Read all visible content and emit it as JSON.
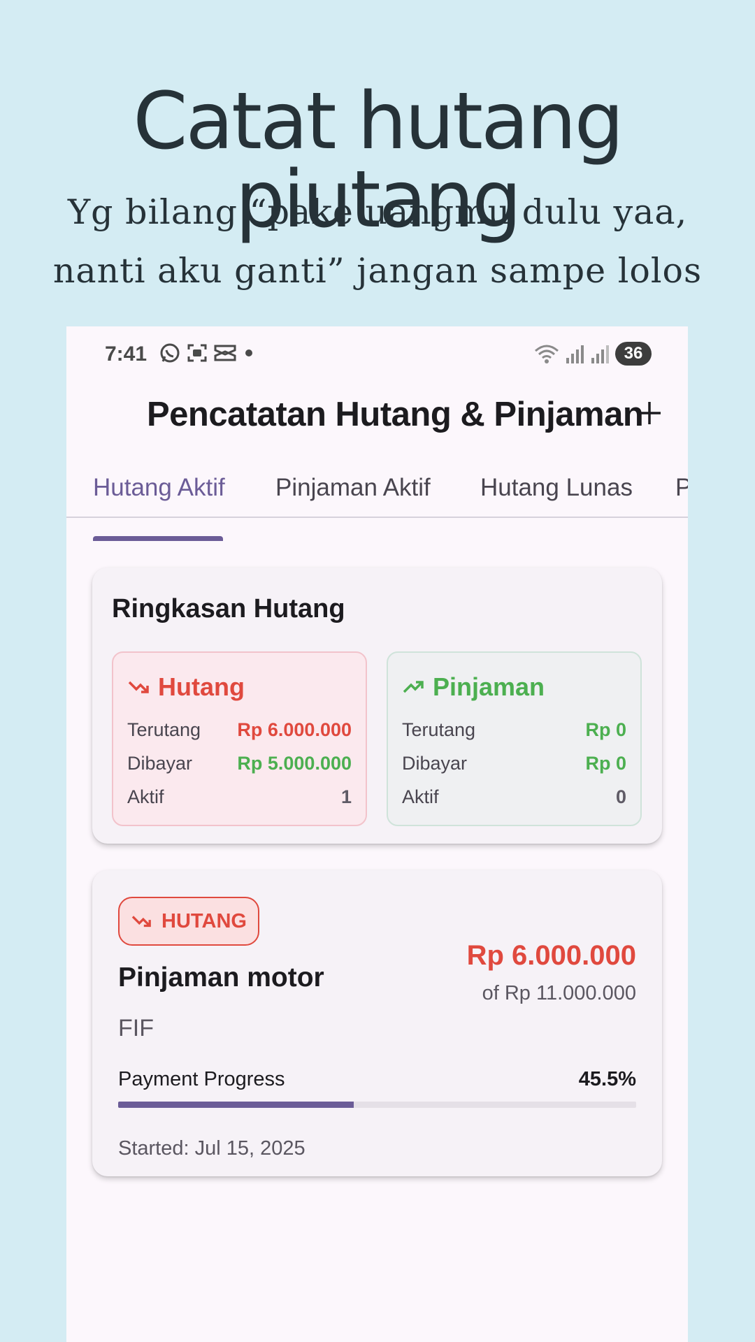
{
  "promo": {
    "title": "Catat hutang piutang",
    "subtitle_line1": "Yg bilang “pake uangmu dulu yaa,",
    "subtitle_line2": "nanti aku ganti” jangan sampe lolos"
  },
  "status_bar": {
    "time": "7:41",
    "battery": "36",
    "left_icons": [
      "whatsapp-icon",
      "screenshot-icon",
      "capcut-icon",
      "dot-icon"
    ],
    "right_icons": [
      "wifi-icon",
      "signal-icon",
      "signal-icon-2"
    ]
  },
  "app_bar": {
    "title": "Pencatatan Hutang & Pinjaman",
    "add_icon": "plus-icon"
  },
  "tabs": [
    {
      "label": "Hutang Aktif",
      "active": true
    },
    {
      "label": "Pinjaman Aktif",
      "active": false
    },
    {
      "label": "Hutang Lunas",
      "active": false
    },
    {
      "label": "P",
      "active": false
    }
  ],
  "summary": {
    "title": "Ringkasan Hutang",
    "debt": {
      "label": "Hutang",
      "icon": "trending-down-icon",
      "rows": [
        {
          "label": "Terutang",
          "value": "Rp 6.000.000"
        },
        {
          "label": "Dibayar",
          "value": "Rp 5.000.000"
        },
        {
          "label": "Aktif",
          "value": "1"
        }
      ]
    },
    "loan": {
      "label": "Pinjaman",
      "icon": "trending-up-icon",
      "rows": [
        {
          "label": "Terutang",
          "value": "Rp 0"
        },
        {
          "label": "Dibayar",
          "value": "Rp 0"
        },
        {
          "label": "Aktif",
          "value": "0"
        }
      ]
    }
  },
  "debt_item": {
    "badge": "HUTANG",
    "name": "Pinjaman motor",
    "lender": "FIF",
    "amount": "Rp 6.000.000",
    "total": "of Rp 11.000.000",
    "progress_label": "Payment Progress",
    "progress_text": "45.5%",
    "progress_value": 0.455,
    "started": "Started: Jul 15, 2025"
  },
  "colors": {
    "accent": "#6b5c97",
    "debt": "#e0493e",
    "loan": "#4caf50",
    "background": "#d4ecf3"
  }
}
